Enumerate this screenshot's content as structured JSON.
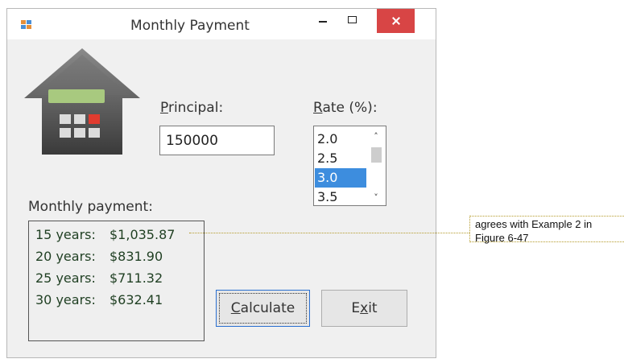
{
  "window": {
    "title": "Monthly Payment",
    "icon": "app-window-icon"
  },
  "logo": {
    "icon": "house-calculator-icon"
  },
  "principal": {
    "label_accel": "P",
    "label_rest": "rincipal:",
    "value": "150000"
  },
  "rate": {
    "label_accel": "R",
    "label_rest": "ate (%):",
    "items": [
      "2.0",
      "2.5",
      "3.0",
      "3.5"
    ],
    "selected": "3.0"
  },
  "payment": {
    "label": "Monthly payment:",
    "rows": [
      {
        "years": "15 years:",
        "amount": "$1,035.87"
      },
      {
        "years": "20 years:",
        "amount": "$831.90"
      },
      {
        "years": "25 years:",
        "amount": "$711.32"
      },
      {
        "years": "30 years:",
        "amount": "$632.41"
      }
    ]
  },
  "buttons": {
    "calculate_accel": "C",
    "calculate_rest": "alculate",
    "exit_pre": "E",
    "exit_accel": "x",
    "exit_post": "it"
  },
  "callout": {
    "text": "agrees with Example 2 in Figure 6-47"
  },
  "colors": {
    "close": "#d84545",
    "selection": "#3d8dde",
    "output_text": "#1f3f22",
    "callout_line": "#b49a2a"
  }
}
